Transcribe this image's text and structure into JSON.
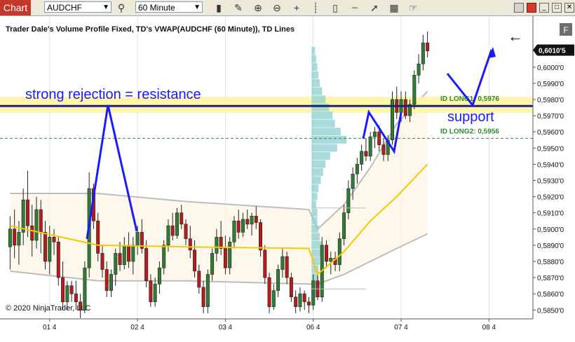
{
  "app": {
    "tab_label": "Chart",
    "instrument": "AUDCHF",
    "interval": "60 Minute",
    "toolbar_icons": [
      "bar-chart-icon",
      "pencil-icon",
      "zoom-in-icon",
      "zoom-out-icon",
      "crosshair-icon",
      "bar-style-icon",
      "candle-style-icon",
      "line-style-icon",
      "trend-icon",
      "indicator-icon",
      "hand-icon"
    ],
    "window_buttons": [
      "minimize-icon",
      "restore-icon",
      "close-icon"
    ],
    "side_button": "F",
    "back_arrow": "←"
  },
  "chart_data": {
    "type": "candlestick",
    "title": "Trader Dale's Volume Profile Fixed, TD's VWAP(AUDCHF (60 Minute)), TD Lines",
    "copyright": "© 2020 NinjaTrader, LLC",
    "y_range": [
      0.58445,
      0.60315
    ],
    "x_range": [
      0,
      99
    ],
    "y_ticks": [
      "0,6000'0",
      "0,5990'0",
      "0,5980'0",
      "0,5970'0",
      "0,5960'0",
      "0,5950'0",
      "0,5940'0",
      "0,5930'0",
      "0,5920'0",
      "0,5910'0",
      "0,5900'0",
      "0,5890'0",
      "0,5880'0",
      "0,5870'0",
      "0,5860'0",
      "0,5850'0"
    ],
    "y_tick_values": [
      0.6,
      0.599,
      0.598,
      0.597,
      0.596,
      0.595,
      0.594,
      0.593,
      0.592,
      0.591,
      0.59,
      0.589,
      0.588,
      0.587,
      0.586,
      0.585
    ],
    "x_ticks": [
      {
        "label": "01 4",
        "x": 9
      },
      {
        "label": "02 4",
        "x": 29
      },
      {
        "label": "03 4",
        "x": 49
      },
      {
        "label": "06 4",
        "x": 69
      },
      {
        "label": "07 4",
        "x": 89
      },
      {
        "label": "08 4",
        "x": 109
      }
    ],
    "last_price": {
      "label": "0,6010'5",
      "value": 0.60105
    },
    "annotations": [
      {
        "text": "strong rejection = resistance",
        "kind": "handwritten"
      },
      {
        "text": "support",
        "kind": "handwritten"
      }
    ],
    "levels": [
      {
        "label": "ID LONG1: 0,5976",
        "value": 0.5976,
        "color": "#1a237e"
      },
      {
        "label": "ID LONG2: 0,5956",
        "value": 0.5956,
        "color": "#2e8b2e"
      }
    ],
    "zones": [
      {
        "from": 0.59717,
        "to": 0.59817,
        "color": "#fff59d"
      }
    ],
    "colors": {
      "up": "#2e7d32",
      "down": "#b71c1c",
      "vwap": "#f5c800",
      "band": "#bdbdbd",
      "profile": "#8ecfd0",
      "annotation": "#1a1aff"
    },
    "candles": [
      {
        "x": 0,
        "o": 0.5889,
        "h": 0.5908,
        "l": 0.5875,
        "c": 0.59
      },
      {
        "x": 1,
        "o": 0.59,
        "h": 0.5912,
        "l": 0.5882,
        "c": 0.589
      },
      {
        "x": 2,
        "o": 0.589,
        "h": 0.5905,
        "l": 0.5878,
        "c": 0.5898
      },
      {
        "x": 3,
        "o": 0.5898,
        "h": 0.5925,
        "l": 0.589,
        "c": 0.5918
      },
      {
        "x": 4,
        "o": 0.5918,
        "h": 0.5936,
        "l": 0.5895,
        "c": 0.5902
      },
      {
        "x": 5,
        "o": 0.5902,
        "h": 0.5915,
        "l": 0.5883,
        "c": 0.5893
      },
      {
        "x": 6,
        "o": 0.5893,
        "h": 0.592,
        "l": 0.5888,
        "c": 0.5912
      },
      {
        "x": 7,
        "o": 0.5912,
        "h": 0.5918,
        "l": 0.5885,
        "c": 0.5898
      },
      {
        "x": 8,
        "o": 0.5898,
        "h": 0.5905,
        "l": 0.5875,
        "c": 0.588
      },
      {
        "x": 9,
        "o": 0.588,
        "h": 0.5902,
        "l": 0.5872,
        "c": 0.5895
      },
      {
        "x": 10,
        "o": 0.5895,
        "h": 0.59,
        "l": 0.5884,
        "c": 0.5892
      },
      {
        "x": 11,
        "o": 0.5892,
        "h": 0.5895,
        "l": 0.5865,
        "c": 0.587
      },
      {
        "x": 12,
        "o": 0.587,
        "h": 0.588,
        "l": 0.585,
        "c": 0.5855
      },
      {
        "x": 13,
        "o": 0.5855,
        "h": 0.5868,
        "l": 0.585,
        "c": 0.5865
      },
      {
        "x": 14,
        "o": 0.5865,
        "h": 0.5868,
        "l": 0.5855,
        "c": 0.586
      },
      {
        "x": 15,
        "o": 0.586,
        "h": 0.5868,
        "l": 0.585,
        "c": 0.5855
      },
      {
        "x": 16,
        "o": 0.5855,
        "h": 0.586,
        "l": 0.5845,
        "c": 0.585
      },
      {
        "x": 17,
        "o": 0.585,
        "h": 0.588,
        "l": 0.5848,
        "c": 0.5876
      },
      {
        "x": 18,
        "o": 0.5876,
        "h": 0.5935,
        "l": 0.587,
        "c": 0.5925
      },
      {
        "x": 19,
        "o": 0.5925,
        "h": 0.5928,
        "l": 0.59,
        "c": 0.5905
      },
      {
        "x": 20,
        "o": 0.5905,
        "h": 0.591,
        "l": 0.588,
        "c": 0.5885
      },
      {
        "x": 21,
        "o": 0.5885,
        "h": 0.589,
        "l": 0.587,
        "c": 0.5875
      },
      {
        "x": 22,
        "o": 0.5875,
        "h": 0.588,
        "l": 0.5858,
        "c": 0.5862
      },
      {
        "x": 23,
        "o": 0.5862,
        "h": 0.5875,
        "l": 0.5858,
        "c": 0.5872
      },
      {
        "x": 24,
        "o": 0.5872,
        "h": 0.5888,
        "l": 0.5865,
        "c": 0.5885
      },
      {
        "x": 25,
        "o": 0.5885,
        "h": 0.5892,
        "l": 0.5874,
        "c": 0.5878
      },
      {
        "x": 26,
        "o": 0.5878,
        "h": 0.5895,
        "l": 0.5875,
        "c": 0.589
      },
      {
        "x": 27,
        "o": 0.589,
        "h": 0.5898,
        "l": 0.5876,
        "c": 0.588
      },
      {
        "x": 28,
        "o": 0.588,
        "h": 0.5895,
        "l": 0.5872,
        "c": 0.589
      },
      {
        "x": 29,
        "o": 0.589,
        "h": 0.5902,
        "l": 0.5884,
        "c": 0.5898
      },
      {
        "x": 30,
        "o": 0.5898,
        "h": 0.5906,
        "l": 0.5885,
        "c": 0.5888
      },
      {
        "x": 31,
        "o": 0.5888,
        "h": 0.5893,
        "l": 0.5864,
        "c": 0.5868
      },
      {
        "x": 32,
        "o": 0.5868,
        "h": 0.5872,
        "l": 0.5852,
        "c": 0.5855
      },
      {
        "x": 33,
        "o": 0.5855,
        "h": 0.587,
        "l": 0.5852,
        "c": 0.5866
      },
      {
        "x": 34,
        "o": 0.5866,
        "h": 0.588,
        "l": 0.586,
        "c": 0.5876
      },
      {
        "x": 35,
        "o": 0.5876,
        "h": 0.5893,
        "l": 0.5872,
        "c": 0.589
      },
      {
        "x": 36,
        "o": 0.589,
        "h": 0.5906,
        "l": 0.5886,
        "c": 0.5902
      },
      {
        "x": 37,
        "o": 0.5902,
        "h": 0.591,
        "l": 0.5893,
        "c": 0.5896
      },
      {
        "x": 38,
        "o": 0.5896,
        "h": 0.5913,
        "l": 0.5894,
        "c": 0.591
      },
      {
        "x": 39,
        "o": 0.591,
        "h": 0.5915,
        "l": 0.59,
        "c": 0.5903
      },
      {
        "x": 40,
        "o": 0.5903,
        "h": 0.5906,
        "l": 0.589,
        "c": 0.5894
      },
      {
        "x": 41,
        "o": 0.5894,
        "h": 0.5902,
        "l": 0.5882,
        "c": 0.5887
      },
      {
        "x": 42,
        "o": 0.5887,
        "h": 0.5893,
        "l": 0.587,
        "c": 0.5874
      },
      {
        "x": 43,
        "o": 0.5874,
        "h": 0.5878,
        "l": 0.586,
        "c": 0.5864
      },
      {
        "x": 44,
        "o": 0.5864,
        "h": 0.5868,
        "l": 0.5848,
        "c": 0.5852
      },
      {
        "x": 45,
        "o": 0.5852,
        "h": 0.5875,
        "l": 0.5848,
        "c": 0.5872
      },
      {
        "x": 46,
        "o": 0.5872,
        "h": 0.5888,
        "l": 0.5868,
        "c": 0.5885
      },
      {
        "x": 47,
        "o": 0.5885,
        "h": 0.59,
        "l": 0.588,
        "c": 0.5895
      },
      {
        "x": 48,
        "o": 0.5895,
        "h": 0.5905,
        "l": 0.5884,
        "c": 0.5888
      },
      {
        "x": 49,
        "o": 0.5888,
        "h": 0.5896,
        "l": 0.5872,
        "c": 0.5876
      },
      {
        "x": 50,
        "o": 0.5876,
        "h": 0.5895,
        "l": 0.5872,
        "c": 0.5892
      },
      {
        "x": 51,
        "o": 0.5892,
        "h": 0.5908,
        "l": 0.5888,
        "c": 0.5905
      },
      {
        "x": 52,
        "o": 0.5905,
        "h": 0.5912,
        "l": 0.5894,
        "c": 0.5898
      },
      {
        "x": 53,
        "o": 0.5898,
        "h": 0.591,
        "l": 0.5895,
        "c": 0.5906
      },
      {
        "x": 54,
        "o": 0.5906,
        "h": 0.5912,
        "l": 0.59,
        "c": 0.5903
      },
      {
        "x": 55,
        "o": 0.5903,
        "h": 0.591,
        "l": 0.5896,
        "c": 0.5908
      },
      {
        "x": 56,
        "o": 0.5908,
        "h": 0.5914,
        "l": 0.59,
        "c": 0.5904
      },
      {
        "x": 57,
        "o": 0.5904,
        "h": 0.5906,
        "l": 0.5883,
        "c": 0.5887
      },
      {
        "x": 58,
        "o": 0.5887,
        "h": 0.589,
        "l": 0.5866,
        "c": 0.587
      },
      {
        "x": 59,
        "o": 0.587,
        "h": 0.5873,
        "l": 0.5848,
        "c": 0.5852
      },
      {
        "x": 60,
        "o": 0.5852,
        "h": 0.5866,
        "l": 0.585,
        "c": 0.5862
      },
      {
        "x": 61,
        "o": 0.5862,
        "h": 0.5878,
        "l": 0.5858,
        "c": 0.5875
      },
      {
        "x": 62,
        "o": 0.5875,
        "h": 0.5888,
        "l": 0.587,
        "c": 0.5883
      },
      {
        "x": 63,
        "o": 0.5883,
        "h": 0.5886,
        "l": 0.5866,
        "c": 0.587
      },
      {
        "x": 64,
        "o": 0.587,
        "h": 0.5873,
        "l": 0.5855,
        "c": 0.5858
      },
      {
        "x": 65,
        "o": 0.5858,
        "h": 0.5862,
        "l": 0.5848,
        "c": 0.5852
      },
      {
        "x": 66,
        "o": 0.5852,
        "h": 0.5864,
        "l": 0.5849,
        "c": 0.586
      },
      {
        "x": 67,
        "o": 0.586,
        "h": 0.5862,
        "l": 0.585,
        "c": 0.5855
      },
      {
        "x": 68,
        "o": 0.5855,
        "h": 0.5858,
        "l": 0.5848,
        "c": 0.5853
      },
      {
        "x": 69,
        "o": 0.5853,
        "h": 0.5872,
        "l": 0.585,
        "c": 0.5868
      },
      {
        "x": 70,
        "o": 0.5868,
        "h": 0.5872,
        "l": 0.5856,
        "c": 0.5858
      },
      {
        "x": 71,
        "o": 0.5858,
        "h": 0.5895,
        "l": 0.5855,
        "c": 0.589
      },
      {
        "x": 72,
        "o": 0.589,
        "h": 0.5893,
        "l": 0.5876,
        "c": 0.588
      },
      {
        "x": 73,
        "o": 0.588,
        "h": 0.5886,
        "l": 0.5872,
        "c": 0.5882
      },
      {
        "x": 74,
        "o": 0.5882,
        "h": 0.5886,
        "l": 0.5874,
        "c": 0.5878
      },
      {
        "x": 75,
        "o": 0.5878,
        "h": 0.5898,
        "l": 0.5874,
        "c": 0.5894
      },
      {
        "x": 76,
        "o": 0.5894,
        "h": 0.5915,
        "l": 0.589,
        "c": 0.591
      },
      {
        "x": 77,
        "o": 0.591,
        "h": 0.593,
        "l": 0.5906,
        "c": 0.5925
      },
      {
        "x": 78,
        "o": 0.5925,
        "h": 0.5938,
        "l": 0.5918,
        "c": 0.5934
      },
      {
        "x": 79,
        "o": 0.5934,
        "h": 0.5944,
        "l": 0.5928,
        "c": 0.594
      },
      {
        "x": 80,
        "o": 0.594,
        "h": 0.5952,
        "l": 0.5936,
        "c": 0.5948
      },
      {
        "x": 81,
        "o": 0.5948,
        "h": 0.5956,
        "l": 0.5942,
        "c": 0.5945
      },
      {
        "x": 82,
        "o": 0.5945,
        "h": 0.596,
        "l": 0.5942,
        "c": 0.5957
      },
      {
        "x": 83,
        "o": 0.5957,
        "h": 0.5963,
        "l": 0.595,
        "c": 0.596
      },
      {
        "x": 84,
        "o": 0.596,
        "h": 0.5964,
        "l": 0.5948,
        "c": 0.5952
      },
      {
        "x": 85,
        "o": 0.5952,
        "h": 0.5956,
        "l": 0.5942,
        "c": 0.5946
      },
      {
        "x": 86,
        "o": 0.5946,
        "h": 0.5958,
        "l": 0.5942,
        "c": 0.5955
      },
      {
        "x": 87,
        "o": 0.5955,
        "h": 0.5985,
        "l": 0.5952,
        "c": 0.598
      },
      {
        "x": 88,
        "o": 0.598,
        "h": 0.5988,
        "l": 0.5968,
        "c": 0.5972
      },
      {
        "x": 89,
        "o": 0.5972,
        "h": 0.5985,
        "l": 0.5966,
        "c": 0.598
      },
      {
        "x": 90,
        "o": 0.598,
        "h": 0.5985,
        "l": 0.5968,
        "c": 0.597
      },
      {
        "x": 91,
        "o": 0.597,
        "h": 0.598,
        "l": 0.5966,
        "c": 0.5977
      },
      {
        "x": 92,
        "o": 0.5977,
        "h": 0.5998,
        "l": 0.5974,
        "c": 0.5995
      },
      {
        "x": 93,
        "o": 0.5995,
        "h": 0.6008,
        "l": 0.599,
        "c": 0.6002
      },
      {
        "x": 94,
        "o": 0.6002,
        "h": 0.602,
        "l": 0.5998,
        "c": 0.6015
      },
      {
        "x": 95,
        "o": 0.6015,
        "h": 0.6022,
        "l": 0.6006,
        "c": 0.601
      }
    ],
    "vwap": [
      {
        "x": 0,
        "y": 0.5902
      },
      {
        "x": 20,
        "y": 0.589
      },
      {
        "x": 40,
        "y": 0.5889
      },
      {
        "x": 68,
        "y": 0.5888
      },
      {
        "x": 70,
        "y": 0.5872
      },
      {
        "x": 76,
        "y": 0.5886
      },
      {
        "x": 82,
        "y": 0.5905
      },
      {
        "x": 88,
        "y": 0.592
      },
      {
        "x": 95,
        "y": 0.594
      }
    ],
    "band_upper": [
      {
        "x": 0,
        "y": 0.5922
      },
      {
        "x": 20,
        "y": 0.5922
      },
      {
        "x": 40,
        "y": 0.5917
      },
      {
        "x": 68,
        "y": 0.5912
      },
      {
        "x": 70,
        "y": 0.59
      },
      {
        "x": 76,
        "y": 0.5915
      },
      {
        "x": 82,
        "y": 0.5938
      },
      {
        "x": 88,
        "y": 0.5965
      },
      {
        "x": 95,
        "y": 0.5985
      }
    ],
    "band_lower": [
      {
        "x": 0,
        "y": 0.5874
      },
      {
        "x": 20,
        "y": 0.5868
      },
      {
        "x": 40,
        "y": 0.5868
      },
      {
        "x": 68,
        "y": 0.5866
      },
      {
        "x": 70,
        "y": 0.5866
      },
      {
        "x": 76,
        "y": 0.5872
      },
      {
        "x": 82,
        "y": 0.588
      },
      {
        "x": 88,
        "y": 0.5888
      },
      {
        "x": 95,
        "y": 0.5897
      }
    ],
    "profile_levels": [
      0.5855,
      0.586,
      0.5865,
      0.587,
      0.5875,
      0.588,
      0.5885,
      0.589,
      0.5895,
      0.59,
      0.5905,
      0.591,
      0.5915,
      0.592,
      0.5925,
      0.593,
      0.5935,
      0.594,
      0.5945,
      0.595,
      0.5955,
      0.596,
      0.5965,
      0.597,
      0.5975,
      0.598,
      0.5985,
      0.599,
      0.5995,
      0.6,
      0.6005,
      0.601
    ],
    "profile_volumes": [
      3,
      4,
      5,
      6,
      6,
      7,
      8,
      9,
      7,
      6,
      5,
      5,
      4,
      5,
      6,
      8,
      10,
      12,
      16,
      22,
      30,
      25,
      20,
      18,
      15,
      12,
      9,
      7,
      6,
      5,
      4,
      3
    ]
  }
}
